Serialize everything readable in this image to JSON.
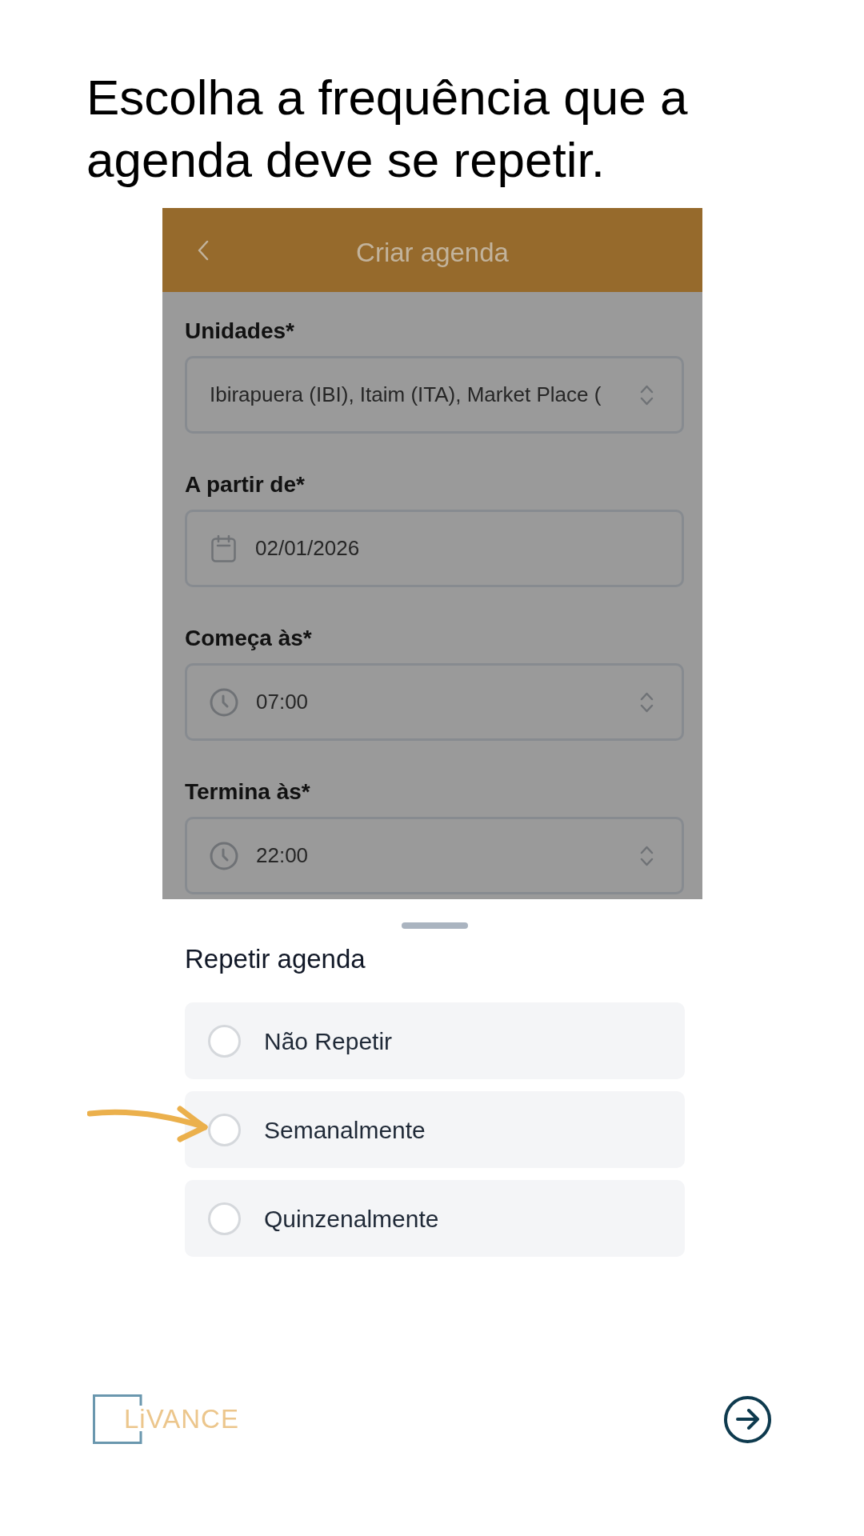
{
  "instruction": {
    "text": "Escolha a frequência que a agenda deve se repetir."
  },
  "app_screen": {
    "header": {
      "title": "Criar agenda"
    },
    "form": {
      "fields": [
        {
          "label": "Unidades*",
          "kind": "select",
          "value": "Ibirapuera (IBI), Itaim (ITA), Market Place ("
        },
        {
          "label": "A partir de*",
          "kind": "date",
          "value": "02/01/2026"
        },
        {
          "label": "Começa às*",
          "kind": "time",
          "value": "07:00"
        },
        {
          "label": "Termina às*",
          "kind": "time",
          "value": "22:00"
        }
      ]
    },
    "bottom_sheet": {
      "title": "Repetir agenda",
      "options": [
        {
          "label": "Não Repetir",
          "selected": false,
          "annotated": false
        },
        {
          "label": "Semanalmente",
          "selected": false,
          "annotated": true
        },
        {
          "label": "Quinzenalmente",
          "selected": false,
          "annotated": false
        }
      ]
    }
  },
  "footer": {
    "brand": "LiVANCE"
  }
}
